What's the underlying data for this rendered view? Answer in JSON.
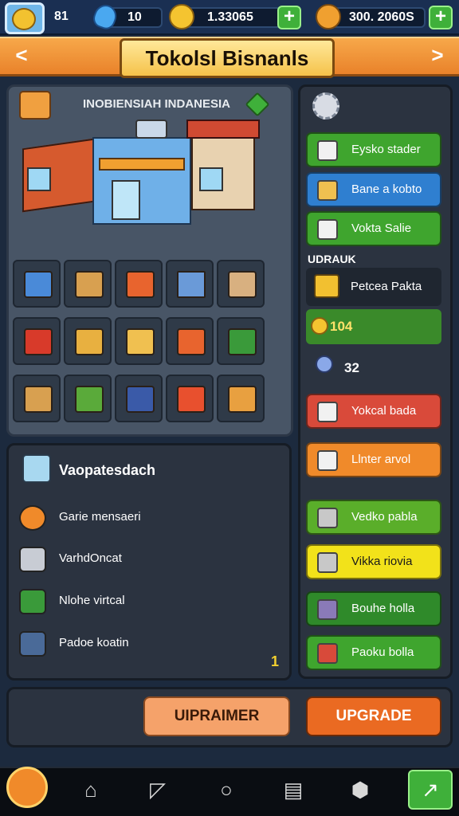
{
  "topbar": {
    "level": "81",
    "gems": "10",
    "coins": "1.33065",
    "cash": "300. 2060S",
    "plus": "+"
  },
  "header": {
    "title": "Tokolsl Bisnanls",
    "left_arrow": "<",
    "right_arrow": ">"
  },
  "store": {
    "name": "INOBIENSIAH INDANESIA"
  },
  "side": {
    "buttons": [
      {
        "label": "Eysko stader"
      },
      {
        "label": "Bane a kobto"
      },
      {
        "label": "Vokta Salie"
      }
    ],
    "section_label": "UDRAUK",
    "info_item": "Petcea Pakta",
    "coin_value": "104",
    "gem_value": "32",
    "actions": [
      {
        "label": "Yokcal bada"
      },
      {
        "label": "Llnter arvol"
      },
      {
        "label": "Vedko pabla"
      },
      {
        "label": "Vikka riovia"
      },
      {
        "label": "Bouhe holla"
      },
      {
        "label": "Paoku bolla"
      }
    ]
  },
  "features": {
    "title": "Vaopatesdach",
    "items": [
      {
        "label": "Garie mensaeri"
      },
      {
        "label": "VarhdOncat"
      },
      {
        "label": "Nlohe virtcal"
      },
      {
        "label": "Padoe koatin"
      }
    ],
    "count": "1"
  },
  "bottom": {
    "upgrade_alt": "UIPRAIMER",
    "upgrade": "UPGRADE"
  },
  "colors": {
    "orange": "#f08a2a",
    "green": "#3fa52e",
    "blue": "#2f7fd0",
    "red": "#d94a3a",
    "yellow": "#f2e21a"
  }
}
